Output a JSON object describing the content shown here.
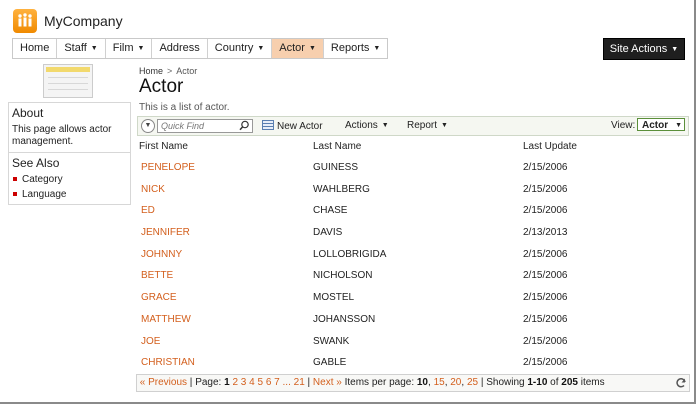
{
  "app": {
    "title": "MyCompany"
  },
  "nav": {
    "items": [
      {
        "label": "Home",
        "dropdown": false,
        "active": false
      },
      {
        "label": "Staff",
        "dropdown": true,
        "active": false
      },
      {
        "label": "Film",
        "dropdown": true,
        "active": false
      },
      {
        "label": "Address",
        "dropdown": false,
        "active": false
      },
      {
        "label": "Country",
        "dropdown": true,
        "active": false
      },
      {
        "label": "Actor",
        "dropdown": true,
        "active": true
      },
      {
        "label": "Reports",
        "dropdown": true,
        "active": false
      }
    ],
    "site_actions": "Site Actions"
  },
  "sidebar": {
    "about_title": "About",
    "about_text": "This page allows actor management.",
    "see_also_title": "See Also",
    "links": [
      "Category",
      "Language"
    ]
  },
  "breadcrumb": {
    "home": "Home",
    "separator": ">",
    "current": "Actor"
  },
  "page": {
    "title": "Actor",
    "description": "This is a list of actor."
  },
  "toolbar": {
    "quick_find_placeholder": "Quick Find",
    "new_label": "New Actor",
    "actions_label": "Actions",
    "report_label": "Report",
    "view_label": "View:",
    "view_value": "Actor"
  },
  "table": {
    "headers": [
      "First Name",
      "Last Name",
      "Last Update"
    ],
    "rows": [
      [
        "PENELOPE",
        "GUINESS",
        "2/15/2006"
      ],
      [
        "NICK",
        "WAHLBERG",
        "2/15/2006"
      ],
      [
        "ED",
        "CHASE",
        "2/15/2006"
      ],
      [
        "JENNIFER",
        "DAVIS",
        "2/13/2013"
      ],
      [
        "JOHNNY",
        "LOLLOBRIGIDA",
        "2/15/2006"
      ],
      [
        "BETTE",
        "NICHOLSON",
        "2/15/2006"
      ],
      [
        "GRACE",
        "MOSTEL",
        "2/15/2006"
      ],
      [
        "MATTHEW",
        "JOHANSSON",
        "2/15/2006"
      ],
      [
        "JOE",
        "SWANK",
        "2/15/2006"
      ],
      [
        "CHRISTIAN",
        "GABLE",
        "2/15/2006"
      ]
    ]
  },
  "pager": {
    "previous": "« Previous",
    "page_label": "Page:",
    "pages": [
      "1",
      "2",
      "3",
      "4",
      "5",
      "6",
      "7",
      "...",
      "21"
    ],
    "current_page": "1",
    "next": "Next »",
    "items_per_page_label": "Items per page:",
    "page_sizes": [
      "10",
      "15",
      "20",
      "25"
    ],
    "current_size": "10",
    "showing_label": "Showing",
    "showing_range": "1-10",
    "of_label": "of",
    "total": "205",
    "items_label": "items"
  },
  "colors": {
    "link": "#d35f1d",
    "active_tab": "#f7cfae",
    "logo": "#f5a01f",
    "bullet": "#cc0000"
  }
}
